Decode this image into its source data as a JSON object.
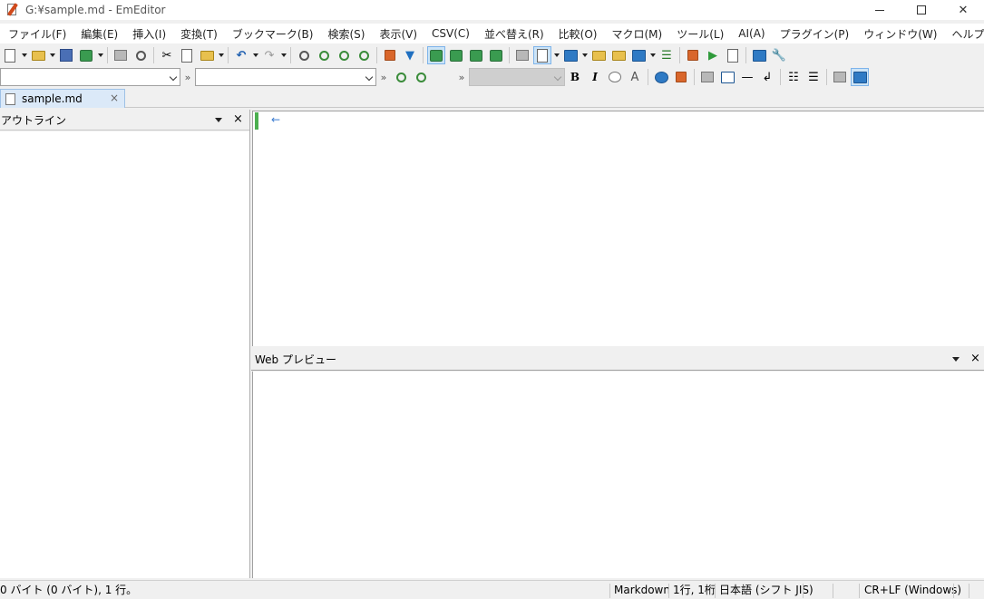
{
  "window": {
    "title": "G:¥sample.md - EmEditor",
    "minimize_icon": "minimize-icon",
    "maximize_icon": "maximize-icon",
    "close_label": "✕"
  },
  "menu": [
    "ファイル(F)",
    "編集(E)",
    "挿入(I)",
    "変換(T)",
    "ブックマーク(B)",
    "検索(S)",
    "表示(V)",
    "CSV(C)",
    "並べ替え(R)",
    "比較(O)",
    "マクロ(M)",
    "ツール(L)",
    "AI(A)",
    "プラグイン(P)",
    "ウィンドウ(W)",
    "ヘルプ(H)"
  ],
  "format_toolbar": {
    "bold": "B",
    "italic": "I",
    "chevron": "»"
  },
  "tabs": [
    {
      "label": "sample.md",
      "close": "×"
    }
  ],
  "outline": {
    "title": "アウトライン",
    "close": "×"
  },
  "editor": {
    "eol_mark": "←"
  },
  "preview": {
    "title": "Web プレビュー",
    "close": "×"
  },
  "status": {
    "size": "0 バイト (0 バイト), 1 行。",
    "mode": "Markdown",
    "position": "1行, 1桁",
    "encoding": "日本語 (シフト JIS)",
    "newline": "CR+LF (Windows)"
  },
  "colors": {
    "accent": "#cce4f7",
    "cursor": "#4caf50"
  }
}
